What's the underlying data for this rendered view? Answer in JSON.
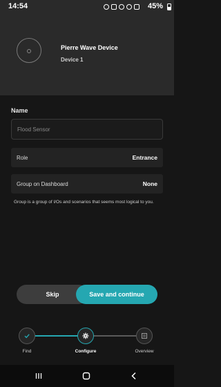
{
  "status_bar": {
    "time": "14:54",
    "battery": "45%",
    "icons": [
      "alarm-icon",
      "mute-icon",
      "location-icon",
      "wifi-icon",
      "signal-icon",
      "battery-icon"
    ]
  },
  "device": {
    "name": "Pierre Wave Device",
    "subtitle": "Device 1"
  },
  "form": {
    "name_label": "Name",
    "name_placeholder": "Flood Sensor",
    "role_label": "Role",
    "role_value": "Entrance",
    "group_label": "Group on Dashboard",
    "group_value": "None",
    "group_hint": "Group is a group of I/Os and scenarios that seems most logical to you."
  },
  "actions": {
    "skip": "Skip",
    "save": "Save and continue"
  },
  "stepper": {
    "steps": [
      {
        "label": "Find",
        "icon": "check-icon",
        "state": "done"
      },
      {
        "label": "Configure",
        "icon": "gear-icon",
        "state": "active"
      },
      {
        "label": "Overview",
        "icon": "overview-icon",
        "state": "todo"
      }
    ]
  },
  "nav": {
    "icons": [
      "recent-apps-icon",
      "home-icon",
      "back-icon"
    ]
  },
  "colors": {
    "accent": "#25a7b1",
    "background": "#161616",
    "header": "#2a2a2a"
  }
}
